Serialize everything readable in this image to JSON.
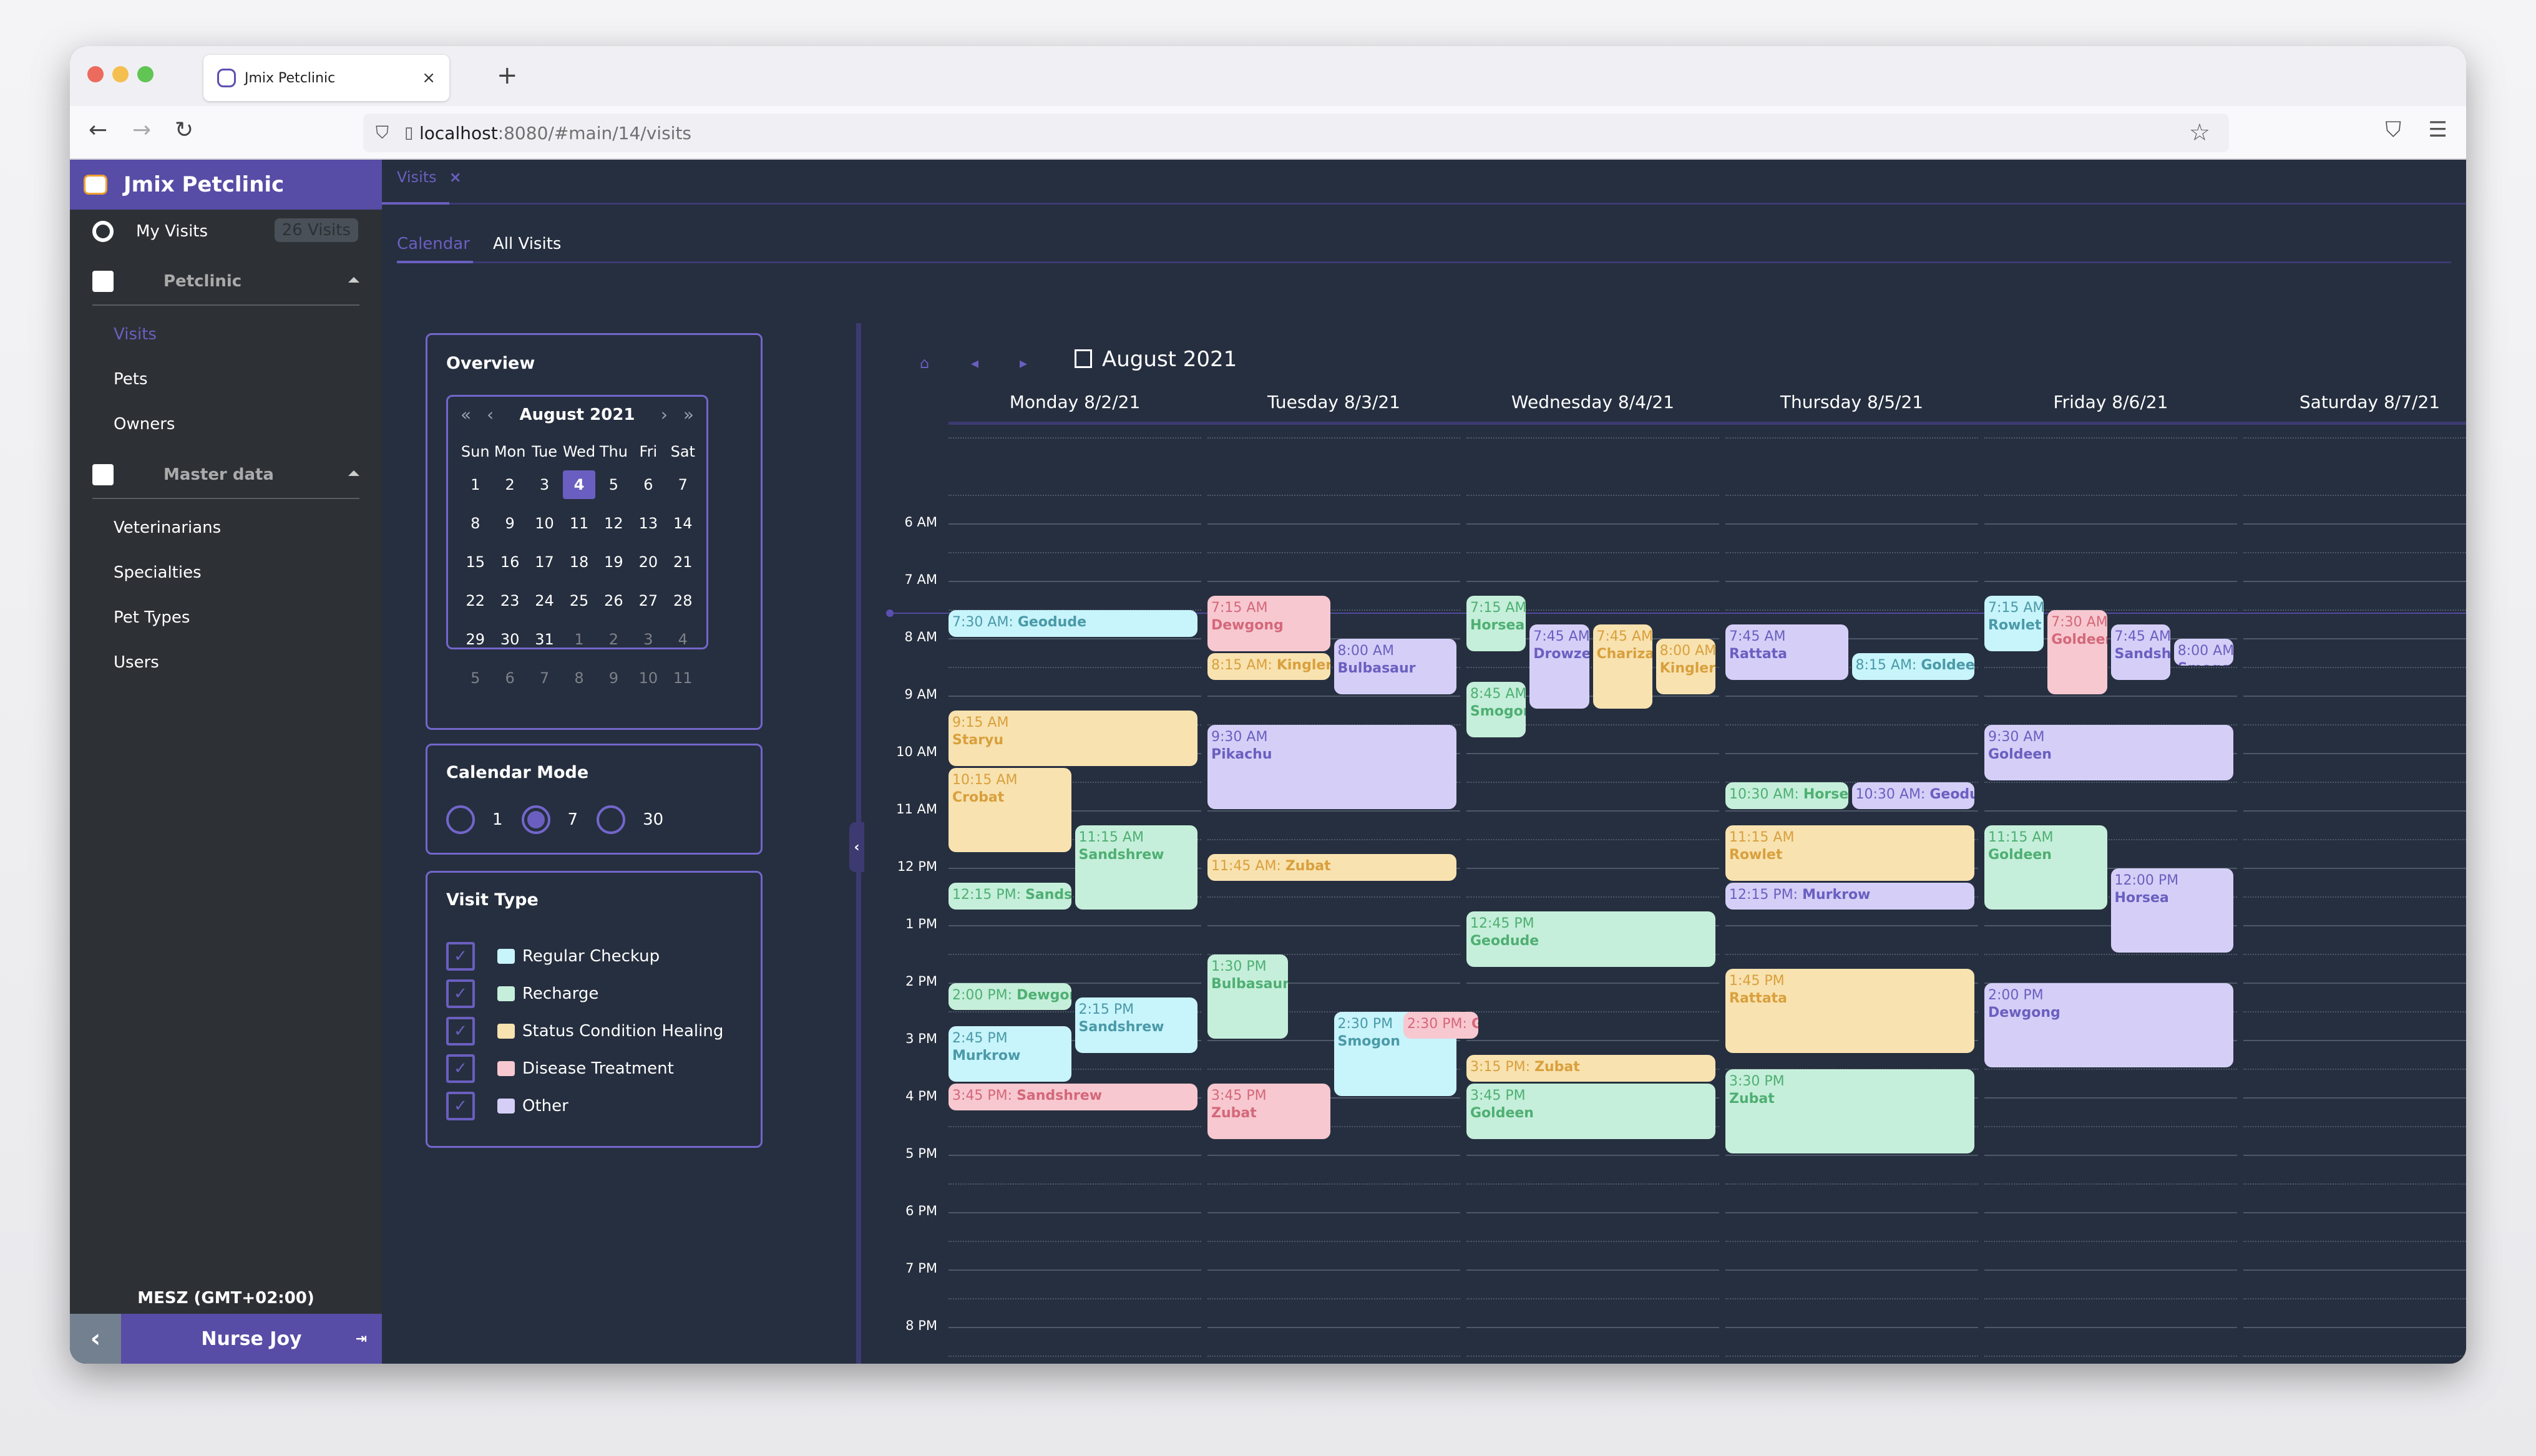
{
  "browser": {
    "tab_title": "Jmix Petclinic",
    "url_host": "localhost",
    "url_path": ":8080/#main/14/visits"
  },
  "app": {
    "title": "Jmix Petclinic",
    "my_visits_label": "My Visits",
    "my_visits_badge": "26 Visits",
    "groups": [
      {
        "label": "Petclinic",
        "items": [
          {
            "label": "Visits",
            "active": true
          },
          {
            "label": "Pets"
          },
          {
            "label": "Owners"
          }
        ]
      },
      {
        "label": "Master data",
        "items": [
          {
            "label": "Veterinarians"
          },
          {
            "label": "Specialties"
          },
          {
            "label": "Pet Types"
          },
          {
            "label": "Users"
          }
        ]
      }
    ],
    "timezone": "MESZ (GMT+02:00)",
    "user_name": "Nurse Joy"
  },
  "main": {
    "view_tab": "Visits",
    "subtabs": [
      "Calendar",
      "All Visits"
    ],
    "active_subtab": "Calendar"
  },
  "overview": {
    "title": "Overview",
    "month_label": "August 2021",
    "weekdays": [
      "Sun",
      "Mon",
      "Tue",
      "Wed",
      "Thu",
      "Fri",
      "Sat"
    ],
    "days": [
      [
        "1",
        "2",
        "3",
        "4",
        "5",
        "6",
        "7"
      ],
      [
        "8",
        "9",
        "10",
        "11",
        "12",
        "13",
        "14"
      ],
      [
        "15",
        "16",
        "17",
        "18",
        "19",
        "20",
        "21"
      ],
      [
        "22",
        "23",
        "24",
        "25",
        "26",
        "27",
        "28"
      ],
      [
        "29",
        "30",
        "31",
        "1",
        "2",
        "3",
        "4"
      ],
      [
        "5",
        "6",
        "7",
        "8",
        "9",
        "10",
        "11"
      ]
    ],
    "selected_day": "4",
    "muted_from_index": 31
  },
  "calendar_mode": {
    "title": "Calendar Mode",
    "options": [
      "1",
      "7",
      "30"
    ],
    "selected": "7"
  },
  "visit_types": {
    "title": "Visit Type",
    "items": [
      {
        "label": "Regular Checkup",
        "checked": true,
        "color": "#c8f4fb",
        "text_color": "#4a9aa8"
      },
      {
        "label": "Recharge",
        "checked": true,
        "color": "#c5efda",
        "text_color": "#4faf73"
      },
      {
        "label": "Status Condition Healing",
        "checked": true,
        "color": "#f8e2b0",
        "text_color": "#d9a03d"
      },
      {
        "label": "Disease Treatment",
        "checked": true,
        "color": "#f7c8d0",
        "text_color": "#d4687a"
      },
      {
        "label": "Other",
        "checked": true,
        "color": "#d5cff8",
        "text_color": "#6a5fc0"
      }
    ]
  },
  "calendar": {
    "title": "August 2021",
    "days": [
      "Monday 8/2/21",
      "Tuesday 8/3/21",
      "Wednesday 8/4/21",
      "Thursday 8/5/21",
      "Friday 8/6/21",
      "Saturday 8/7/21"
    ],
    "hours": [
      "6 AM",
      "7 AM",
      "8 AM",
      "9 AM",
      "10 AM",
      "11 AM",
      "12 PM",
      "1 PM",
      "2 PM",
      "3 PM",
      "4 PM",
      "5 PM",
      "6 PM",
      "7 PM",
      "8 PM"
    ],
    "events": [
      {
        "day": 0,
        "start": 7.5,
        "end": 8.0,
        "col": 0,
        "cols": 1,
        "type": 4,
        "time": "7:30 AM:",
        "pet": "Geodude",
        "inline": true,
        "type_index": 0
      },
      {
        "day": 0,
        "start": 9.25,
        "end": 10.25,
        "col": 0,
        "cols": 1,
        "type_index": 2,
        "time": "9:15 AM",
        "pet": "Staryu"
      },
      {
        "day": 0,
        "start": 10.25,
        "end": 11.75,
        "col": 0,
        "cols": 2,
        "type_index": 2,
        "time": "10:15 AM",
        "pet": "Crobat"
      },
      {
        "day": 0,
        "start": 11.25,
        "end": 12.75,
        "col": 1,
        "cols": 2,
        "type_index": 1,
        "time": "11:15 AM",
        "pet": "Sandshrew"
      },
      {
        "day": 0,
        "start": 12.25,
        "end": 12.75,
        "col": 0,
        "cols": 2,
        "type_index": 1,
        "time": "12:15 PM:",
        "pet": "Sandshrew",
        "inline": true
      },
      {
        "day": 0,
        "start": 14.0,
        "end": 14.5,
        "col": 0,
        "cols": 2,
        "type_index": 1,
        "time": "2:00 PM:",
        "pet": "Dewgong",
        "inline": true
      },
      {
        "day": 0,
        "start": 14.25,
        "end": 15.25,
        "col": 1,
        "cols": 2,
        "type_index": 0,
        "time": "2:15 PM",
        "pet": "Sandshrew"
      },
      {
        "day": 0,
        "start": 14.75,
        "end": 15.75,
        "col": 0,
        "cols": 2,
        "type_index": 0,
        "time": "2:45 PM",
        "pet": "Murkrow"
      },
      {
        "day": 0,
        "start": 15.75,
        "end": 16.25,
        "col": 0,
        "cols": 1,
        "type_index": 3,
        "time": "3:45 PM:",
        "pet": "Sandshrew",
        "inline": true
      },
      {
        "day": 1,
        "start": 7.25,
        "end": 8.25,
        "col": 0,
        "cols": 2,
        "type_index": 3,
        "time": "7:15 AM",
        "pet": "Dewgong"
      },
      {
        "day": 1,
        "start": 8.25,
        "end": 8.75,
        "col": 0,
        "cols": 2,
        "type_index": 2,
        "time": "8:15 AM:",
        "pet": "Kingler",
        "inline": true
      },
      {
        "day": 1,
        "start": 8.0,
        "end": 9.0,
        "col": 1,
        "cols": 2,
        "type_index": 4,
        "time": "8:00 AM",
        "pet": "Bulbasaur"
      },
      {
        "day": 1,
        "start": 9.5,
        "end": 11.0,
        "col": 0,
        "cols": 1,
        "type_index": 4,
        "time": "9:30 AM",
        "pet": "Pikachu"
      },
      {
        "day": 1,
        "start": 11.75,
        "end": 12.25,
        "col": 0,
        "cols": 1,
        "type_index": 2,
        "time": "11:45 AM:",
        "pet": "Zubat",
        "inline": true
      },
      {
        "day": 1,
        "start": 13.5,
        "end": 15.0,
        "col": 0,
        "cols": 3,
        "type_index": 1,
        "time": "1:30 PM",
        "pet": "Bulbasaur"
      },
      {
        "day": 1,
        "start": 14.5,
        "end": 16.0,
        "col": 2,
        "cols": 4,
        "span": 2,
        "type_index": 0,
        "time": "2:30 PM",
        "pet": "Smogon"
      },
      {
        "day": 1,
        "start": 14.5,
        "end": 15.0,
        "col": 3,
        "cols": 4,
        "span": 1.25,
        "offset": 0.1,
        "type_index": 3,
        "time": "2:30 PM:",
        "pet": "Goldeen",
        "inline": true
      },
      {
        "day": 1,
        "start": 15.75,
        "end": 16.75,
        "col": 0,
        "cols": 2,
        "type_index": 3,
        "time": "3:45 PM",
        "pet": "Zubat"
      },
      {
        "day": 2,
        "start": 7.25,
        "end": 8.25,
        "col": 0,
        "cols": 4,
        "type_index": 1,
        "time": "7:15 AM",
        "pet": "Horsea"
      },
      {
        "day": 2,
        "start": 8.75,
        "end": 9.75,
        "col": 0,
        "cols": 4,
        "type_index": 1,
        "time": "8:45 AM",
        "pet": "Smogon"
      },
      {
        "day": 2,
        "start": 7.75,
        "end": 9.25,
        "col": 1,
        "cols": 4,
        "type_index": 4,
        "time": "7:45 AM",
        "pet": "Drowzee"
      },
      {
        "day": 2,
        "start": 7.75,
        "end": 9.25,
        "col": 2,
        "cols": 4,
        "type_index": 2,
        "time": "7:45 AM",
        "pet": "Charizard"
      },
      {
        "day": 2,
        "start": 8.0,
        "end": 9.0,
        "col": 3,
        "cols": 4,
        "type_index": 2,
        "time": "8:00 AM",
        "pet": "Kingler"
      },
      {
        "day": 2,
        "start": 12.75,
        "end": 13.75,
        "col": 0,
        "cols": 1,
        "type_index": 1,
        "time": "12:45 PM",
        "pet": "Geodude"
      },
      {
        "day": 2,
        "start": 15.25,
        "end": 15.75,
        "col": 0,
        "cols": 1,
        "type_index": 2,
        "time": "3:15 PM:",
        "pet": "Zubat",
        "inline": true
      },
      {
        "day": 2,
        "start": 15.75,
        "end": 16.75,
        "col": 0,
        "cols": 1,
        "type_index": 1,
        "time": "3:45 PM",
        "pet": "Goldeen"
      },
      {
        "day": 3,
        "start": 7.75,
        "end": 8.75,
        "col": 0,
        "cols": 2,
        "type_index": 4,
        "time": "7:45 AM",
        "pet": "Rattata"
      },
      {
        "day": 3,
        "start": 8.25,
        "end": 8.75,
        "col": 1,
        "cols": 2,
        "type_index": 0,
        "time": "8:15 AM:",
        "pet": "Goldeen",
        "inline": true
      },
      {
        "day": 3,
        "start": 10.5,
        "end": 11.0,
        "col": 0,
        "cols": 2,
        "type_index": 1,
        "time": "10:30 AM:",
        "pet": "Horsea",
        "inline": true
      },
      {
        "day": 3,
        "start": 10.5,
        "end": 11.0,
        "col": 1,
        "cols": 2,
        "type_index": 4,
        "time": "10:30 AM:",
        "pet": "Geodude",
        "inline": true
      },
      {
        "day": 3,
        "start": 11.25,
        "end": 12.25,
        "col": 0,
        "cols": 1,
        "type_index": 2,
        "time": "11:15 AM",
        "pet": "Rowlet"
      },
      {
        "day": 3,
        "start": 12.25,
        "end": 12.75,
        "col": 0,
        "cols": 1,
        "type_index": 4,
        "time": "12:15 PM:",
        "pet": "Murkrow",
        "inline": true
      },
      {
        "day": 3,
        "start": 13.75,
        "end": 15.25,
        "col": 0,
        "cols": 1,
        "type_index": 2,
        "time": "1:45 PM",
        "pet": "Rattata"
      },
      {
        "day": 3,
        "start": 15.5,
        "end": 17.0,
        "col": 0,
        "cols": 1,
        "type_index": 1,
        "time": "3:30 PM",
        "pet": "Zubat"
      },
      {
        "day": 4,
        "start": 7.25,
        "end": 8.25,
        "col": 0,
        "cols": 4,
        "type_index": 0,
        "time": "7:15 AM",
        "pet": "Rowlet"
      },
      {
        "day": 4,
        "start": 7.5,
        "end": 9.0,
        "col": 1,
        "cols": 4,
        "type_index": 3,
        "time": "7:30 AM",
        "pet": "Goldeen"
      },
      {
        "day": 4,
        "start": 7.75,
        "end": 8.75,
        "col": 2,
        "cols": 4,
        "type_index": 4,
        "time": "7:45 AM",
        "pet": "Sandshrew"
      },
      {
        "day": 4,
        "start": 8.0,
        "end": 8.5,
        "col": 3,
        "cols": 4,
        "type_index": 4,
        "time": "8:00 AM",
        "pet": "Smogon"
      },
      {
        "day": 4,
        "start": 9.5,
        "end": 10.5,
        "col": 0,
        "cols": 1,
        "type_index": 4,
        "time": "9:30 AM",
        "pet": "Goldeen"
      },
      {
        "day": 4,
        "start": 11.25,
        "end": 12.75,
        "col": 0,
        "cols": 2,
        "type_index": 1,
        "time": "11:15 AM",
        "pet": "Goldeen"
      },
      {
        "day": 4,
        "start": 12.0,
        "end": 13.5,
        "col": 1,
        "cols": 2,
        "type_index": 4,
        "time": "12:00 PM",
        "pet": "Horsea"
      },
      {
        "day": 4,
        "start": 14.0,
        "end": 15.5,
        "col": 0,
        "cols": 1,
        "type_index": 4,
        "time": "2:00 PM",
        "pet": "Dewgong"
      }
    ]
  }
}
